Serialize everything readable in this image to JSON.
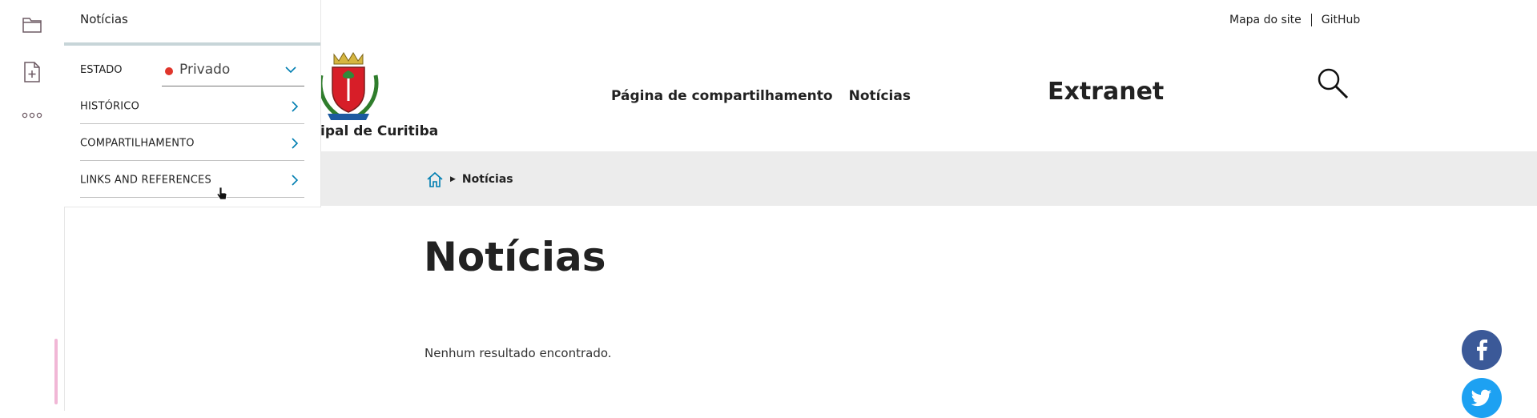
{
  "toolbar": {
    "icons": [
      "folder-icon",
      "add-document-icon",
      "more-icon"
    ]
  },
  "panel": {
    "title": "Notícias",
    "state": {
      "label": "ESTADO",
      "value": "Privado",
      "color": "#e0352b"
    },
    "rows": [
      {
        "label": "HISTÓRICO"
      },
      {
        "label": "COMPARTILHAMENTO"
      },
      {
        "label": "LINKS AND REFERENCES"
      }
    ]
  },
  "header": {
    "links": [
      "Mapa do site",
      "GitHub"
    ],
    "site_name": "nicipal de Curitiba",
    "nav": [
      "Página de compartilhamento",
      "Notícias"
    ],
    "extranet": "Extranet"
  },
  "breadcrumb": {
    "current": "Notícias"
  },
  "main": {
    "title": "Notícias",
    "empty_message": "Nenhum resultado encontrado."
  },
  "social": [
    "facebook-icon",
    "twitter-icon"
  ],
  "colors": {
    "accent_link": "#007eb1",
    "facebook": "#3b5998",
    "twitter": "#1da1f2",
    "crumb_bg": "#ececec"
  }
}
